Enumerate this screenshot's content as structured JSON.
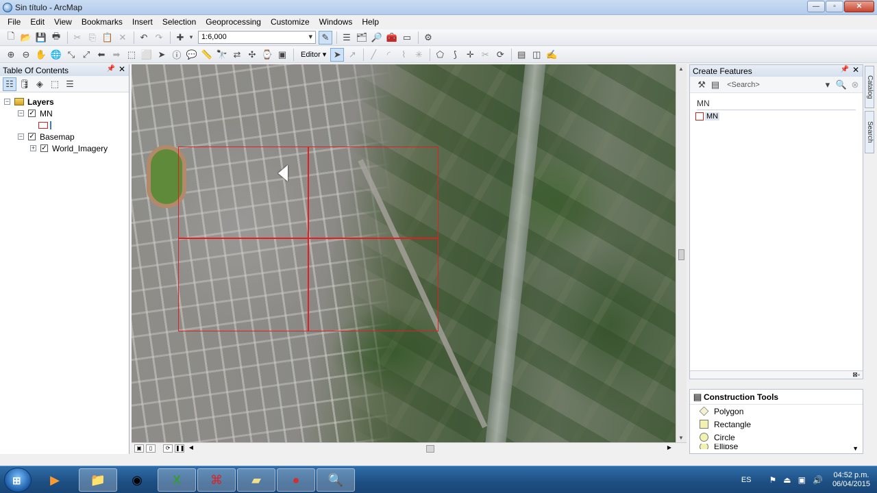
{
  "window": {
    "title": "Sin título - ArcMap"
  },
  "menu": [
    "File",
    "Edit",
    "View",
    "Bookmarks",
    "Insert",
    "Selection",
    "Geoprocessing",
    "Customize",
    "Windows",
    "Help"
  ],
  "toolbar": {
    "scale": "1:6,000",
    "editor_label": "Editor"
  },
  "toc": {
    "title": "Table Of Contents",
    "root": "Layers",
    "layer1": "MN",
    "group": "Basemap",
    "basemap_layer": "World_Imagery"
  },
  "create_features": {
    "title": "Create Features",
    "search_placeholder": "<Search>",
    "group": "MN",
    "template": "MN"
  },
  "construction_tools": {
    "title": "Construction Tools",
    "items": [
      "Polygon",
      "Rectangle",
      "Circle",
      "Ellipse"
    ]
  },
  "side_tabs": [
    "Catalog",
    "Search"
  ],
  "taskbar": {
    "language": "ES",
    "time": "04:52 p.m.",
    "date": "06/04/2015"
  },
  "colors": {
    "grid_line": "#e02020",
    "selection": "#cde2f7"
  }
}
